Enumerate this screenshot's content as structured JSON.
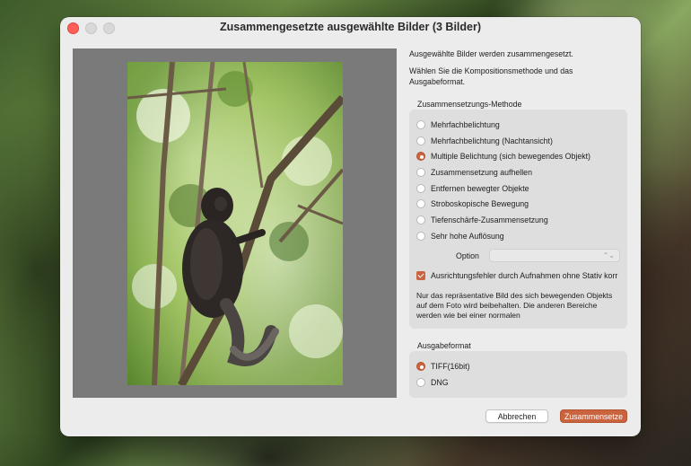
{
  "window": {
    "title": "Zusammengesetzte ausgewählte Bilder (3 Bilder)"
  },
  "intro": {
    "line1": "Ausgewählte Bilder werden zusammengesetzt.",
    "line2": "Wählen Sie die Kompositionsmethode und das Ausgabeformat."
  },
  "method": {
    "label": "Zusammensetzungs-Methode",
    "options": [
      {
        "label": "Mehrfachbelichtung",
        "selected": false
      },
      {
        "label": "Mehrfachbelichtung (Nachtansicht)",
        "selected": false
      },
      {
        "label": "Multiple Belichtung (sich bewegendes Objekt)",
        "selected": true
      },
      {
        "label": "Zusammensetzung aufhellen",
        "selected": false
      },
      {
        "label": "Entfernen bewegter Objekte",
        "selected": false
      },
      {
        "label": "Stroboskopische Bewegung",
        "selected": false
      },
      {
        "label": "Tiefenschärfe-Zusammensetzung",
        "selected": false
      },
      {
        "label": "Sehr hohe Auflösung",
        "selected": false
      }
    ],
    "option_label": "Option",
    "option_value": "",
    "checkbox_label": "Ausrichtungsfehler durch Aufnahmen ohne Stativ korr",
    "checkbox_checked": true,
    "description": "Nur das repräsentative Bild des sich bewegenden Objekts auf dem Foto wird beibehalten. Die anderen Bereiche werden wie bei einer normalen"
  },
  "format": {
    "label": "Ausgabeformat",
    "options": [
      {
        "label": "TIFF(16bit)",
        "selected": true
      },
      {
        "label": "DNG",
        "selected": false
      }
    ]
  },
  "buttons": {
    "cancel": "Abbrechen",
    "ok": "Zusammensetze"
  },
  "colors": {
    "accent": "#c9643f",
    "window_bg": "#ececec",
    "group_bg": "#dedede",
    "preview_bg": "#7a7a7a"
  }
}
